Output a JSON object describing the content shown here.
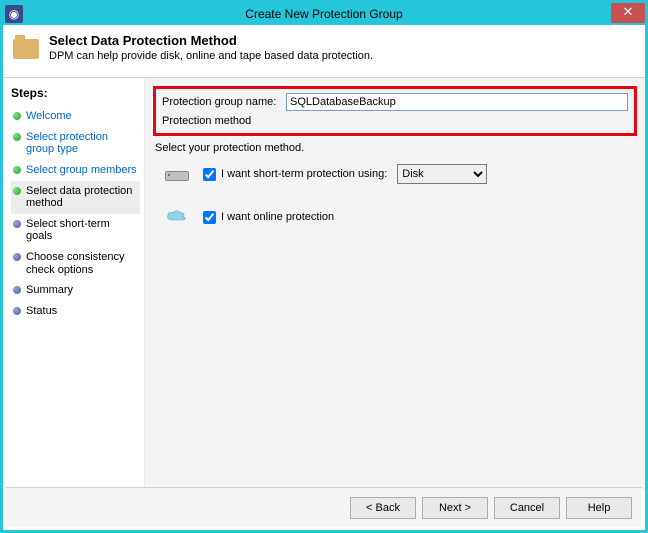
{
  "title": "Create New Protection Group",
  "header": {
    "heading": "Select Data Protection Method",
    "sub": "DPM can help provide disk, online and tape based data protection."
  },
  "sidebar": {
    "title": "Steps:",
    "items": [
      {
        "label": "Welcome",
        "state": "done"
      },
      {
        "label": "Select protection group type",
        "state": "done"
      },
      {
        "label": "Select group members",
        "state": "done"
      },
      {
        "label": "Select data protection method",
        "state": "current"
      },
      {
        "label": "Select short-term goals",
        "state": "pending"
      },
      {
        "label": "Choose consistency check options",
        "state": "pending"
      },
      {
        "label": "Summary",
        "state": "pending"
      },
      {
        "label": "Status",
        "state": "pending"
      }
    ]
  },
  "form": {
    "name_label": "Protection group name:",
    "name_value": "SQLDatabaseBackup",
    "method_label": "Protection method",
    "instruction": "Select your protection method.",
    "short_term_label": "I want short-term protection using:",
    "short_term_checked": true,
    "short_term_option": "Disk",
    "online_label": "I want online protection",
    "online_checked": true
  },
  "buttons": {
    "back": "< Back",
    "next": "Next >",
    "cancel": "Cancel",
    "help": "Help"
  }
}
